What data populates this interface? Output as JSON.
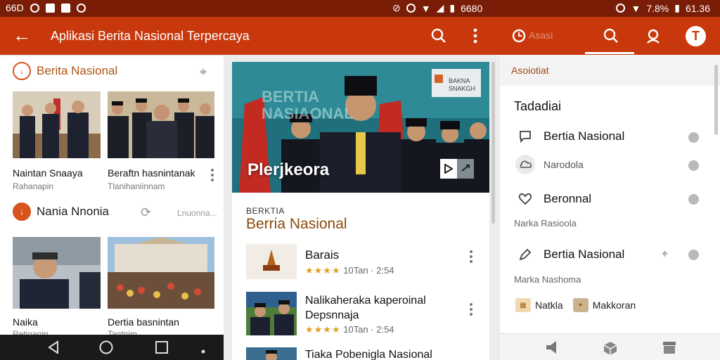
{
  "status_bar": {
    "left_text": "66D",
    "center_text": "6680",
    "battery": "7.8%",
    "time": "61.36"
  },
  "app_bar": {
    "title": "Aplikasi Berita Nasional Terpercaya",
    "tab_text": "Asasi"
  },
  "left_panel": {
    "section1_title": "Berita Nasional",
    "cards_row1": [
      {
        "title": "Naintan Snaaya",
        "sub": "Rahanapin"
      },
      {
        "title": "Beraftn hasnintanak",
        "sub": "Tlanihaniinnam"
      }
    ],
    "section2_title": "Nania Nnonia",
    "section2_more": "Lnuonna...",
    "cards_row2": [
      {
        "title": "Naika",
        "sub": "Retioanin"
      },
      {
        "title": "Dertia basnintan",
        "sub": "Tantnim"
      }
    ]
  },
  "mid_panel": {
    "hero_bg_title": "BERTIA NASIAONAL",
    "hero_sign": "BAKNA SNAKGH",
    "hero_title": "Plerjkeora",
    "kicker": "BERKTIA",
    "heading": "Berria Nasional",
    "articles": [
      {
        "title": "Barais",
        "title2": "",
        "stars": "★★★★",
        "meta": "10Tan · 2:54"
      },
      {
        "title": "Nalikaheraka kaperoinal",
        "title2": "Depsnnaja",
        "stars": "★★★★",
        "meta": "10Tan · 2:54"
      },
      {
        "title": "Tiaka Pobenigla Nasional",
        "title2": "",
        "stars": "",
        "meta": ""
      }
    ]
  },
  "right_panel": {
    "top_label": "Asoiotiat",
    "heading": "Tadadiai",
    "items": [
      {
        "label": "Bertia Nasional"
      },
      {
        "label": "Narodola"
      },
      {
        "label": "Beronnal"
      }
    ],
    "sub1": "Narka Rasioola",
    "item4_label": "Bertia Nasional",
    "sub2": "Marka Nashoma",
    "chip1": "Natkla",
    "chip2": "Makkoran"
  },
  "colors": {
    "status_bar": "#7a1d06",
    "app_bar": "#c8380c",
    "accent": "#d9531f"
  }
}
